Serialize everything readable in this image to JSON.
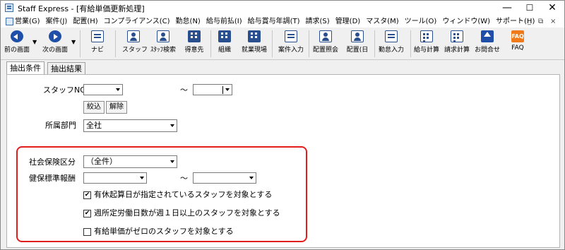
{
  "window": {
    "title": "Staff Express - [有給単価更新処理]",
    "controls": {
      "minimize": "—",
      "maximize": "☐",
      "close": "✕"
    }
  },
  "menubar": {
    "items": [
      "営業(G)",
      "案件(J)",
      "配置(H)",
      "コンプライアンス(C)",
      "勤怠(N)",
      "給与前払(I)",
      "給与賞与年調(T)",
      "請求(S)",
      "管理(D)",
      "マスタ(M)",
      "ツール(O)",
      "ウィンドウ(W)",
      "サポート(H)"
    ],
    "mdi_controls": {
      "minimize": "_",
      "restore": "⧉",
      "close": "×"
    }
  },
  "toolbar": {
    "back": "前の画面",
    "forward": "次の画面",
    "navi": "ナビ",
    "staff": "スタッフ",
    "staff_search": "ｽﾀｯﾌ検索",
    "client": "得意先",
    "organization": "組織",
    "worksite": "就業現場",
    "case_entry": "案件入力",
    "assignment_inquiry": "配置照会",
    "assignment_day": "配置(日",
    "attendance_entry": "勤怠入力",
    "payroll_calc": "給与計算",
    "billing_calc": "請求計算",
    "inquiry": "お問合せ",
    "faq": "FAQ",
    "faq_icon_text": "FAQ"
  },
  "tabs": [
    "抽出条件",
    "抽出結果"
  ],
  "form": {
    "staff_no_label": "スタッフNO",
    "staff_no_from": "",
    "range_sep": "～",
    "staff_no_to": "",
    "filter_button": "絞込",
    "clear_button": "解除",
    "department_label": "所属部門",
    "department_value": "全社",
    "social_insurance_label": "社会保険区分",
    "social_insurance_value": "（全件）",
    "health_standard_label": "健保標準報酬",
    "health_from": "",
    "health_to": "",
    "checkboxes": [
      {
        "label": "有休起算日が指定されているスタッフを対象とする",
        "checked": true
      },
      {
        "label": "週所定労働日数が週１日以上のスタッフを対象とする",
        "checked": true
      },
      {
        "label": "有給単価がゼロのスタッフを対象とする",
        "checked": false
      }
    ]
  },
  "colors": {
    "highlight_border": "#e31c1c",
    "icon_blue": "#1f4fa8",
    "faq_orange": "#f07a1a"
  }
}
